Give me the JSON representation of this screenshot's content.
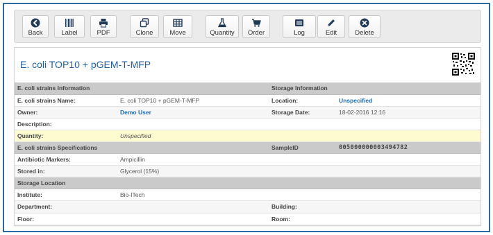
{
  "toolbar": {
    "buttons": [
      {
        "label": "Back",
        "icon": "back-circle-icon"
      },
      {
        "label": "Label",
        "icon": "barcode-icon"
      },
      {
        "label": "PDF",
        "icon": "printer-icon"
      },
      {
        "label": "Clone",
        "icon": "clone-icon"
      },
      {
        "label": "Move",
        "icon": "grid-icon"
      },
      {
        "label": "Quantity",
        "icon": "flask-icon"
      },
      {
        "label": "Order",
        "icon": "cart-icon"
      },
      {
        "label": "Log",
        "icon": "list-icon"
      },
      {
        "label": "Edit",
        "icon": "pencil-icon"
      },
      {
        "label": "Delete",
        "icon": "delete-circle-icon"
      }
    ]
  },
  "record": {
    "title": "E. coli TOP10 + pGEM-T-MFP"
  },
  "sections": {
    "strain_info": "E. coli strains Information",
    "storage_info": "Storage Information",
    "specs": "E. coli strains Specifications",
    "sample_id_label": "SampleID",
    "sample_id_value": "005000000003494782",
    "storage_location": "Storage Location"
  },
  "fields": {
    "name_label": "E. coli strains Name:",
    "name_value": "E. coli TOP10 + pGEM-T-MFP",
    "location_label": "Location:",
    "location_value": "Unspecified",
    "owner_label": "Owner:",
    "owner_value": "Demo User",
    "storage_date_label": "Storage Date:",
    "storage_date_value": "18-02-2016 12:16",
    "description_label": "Description:",
    "quantity_label": "Quantity:",
    "quantity_value": "Unspecified",
    "markers_label": "Antibiotic Markers:",
    "markers_value": "Ampicillin",
    "stored_label": "Stored in:",
    "stored_value": "Glycerol (15%)",
    "institute_label": "Institute:",
    "institute_value": "Bio-ITech",
    "department_label": "Department:",
    "building_label": "Building:",
    "floor_label": "Floor:",
    "room_label": "Room:"
  },
  "colors": {
    "accent": "#1f5f9e",
    "link": "#1f6cb5",
    "section_bg": "#cacaca",
    "highlight_bg": "#fffbd0",
    "frame": "#2c6aa6"
  }
}
